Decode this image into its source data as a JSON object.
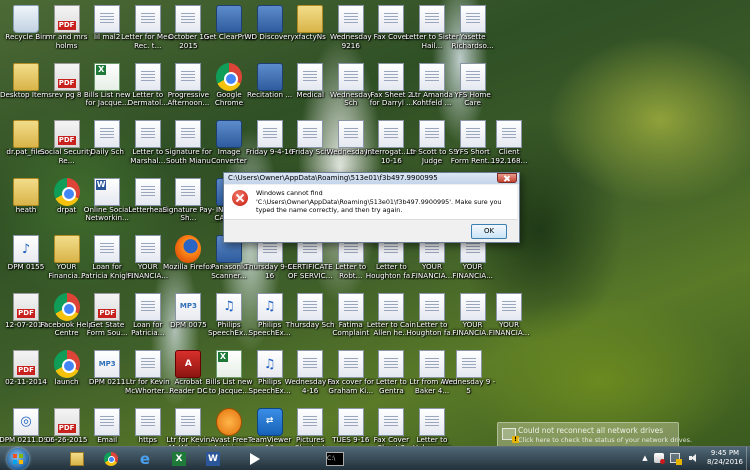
{
  "desktop": {
    "icons": [
      {
        "label": "Recycle Bin",
        "type": "recycle",
        "glyph": ""
      },
      {
        "label": "mr and mrs holms",
        "type": "pdf",
        "glyph": ""
      },
      {
        "label": "lil mal2",
        "type": "doc",
        "glyph": ""
      },
      {
        "label": "Letter for Med. Rec. t...",
        "type": "doc",
        "glyph": ""
      },
      {
        "label": "October 16 2015",
        "type": "doc",
        "glyph": ""
      },
      {
        "label": "Get ClearPrint",
        "type": "appx",
        "glyph": ""
      },
      {
        "label": "WD Discovery",
        "type": "appx",
        "glyph": ""
      },
      {
        "label": "xfactyNs",
        "type": "folder",
        "glyph": ""
      },
      {
        "label": "Wednesday 9216",
        "type": "doc",
        "glyph": ""
      },
      {
        "label": "Fax Cover",
        "type": "doc",
        "glyph": ""
      },
      {
        "label": "Letter to Sister Hail...",
        "type": "doc",
        "glyph": ""
      },
      {
        "label": "Yasette Richardso...",
        "type": "doc",
        "glyph": ""
      },
      {
        "label": "Desktop Items",
        "type": "folder",
        "glyph": ""
      },
      {
        "label": "rev pg 8",
        "type": "pdf",
        "glyph": ""
      },
      {
        "label": "Bills List new for Jacque...",
        "type": "xls",
        "glyph": ""
      },
      {
        "label": "Letter to Dermatol...",
        "type": "doc",
        "glyph": ""
      },
      {
        "label": "Progressive Afternoon...",
        "type": "doc",
        "glyph": ""
      },
      {
        "label": "Google Chrome",
        "type": "chrome",
        "glyph": ""
      },
      {
        "label": "Recitation ...",
        "type": "appx",
        "glyph": ""
      },
      {
        "label": "Medical",
        "type": "doc",
        "glyph": ""
      },
      {
        "label": "Wednesday Sch",
        "type": "doc",
        "glyph": ""
      },
      {
        "label": "Fax Sheet 2 for Darryl ...",
        "type": "doc",
        "glyph": ""
      },
      {
        "label": "Ltr Amanda Kohtfeld ...",
        "type": "doc",
        "glyph": ""
      },
      {
        "label": "YFS Home Care",
        "type": "doc",
        "glyph": ""
      },
      {
        "label": "dr.pat_files",
        "type": "folder",
        "glyph": ""
      },
      {
        "label": "Social Security Re...",
        "type": "pdf",
        "glyph": ""
      },
      {
        "label": "Daily Sch",
        "type": "doc",
        "glyph": ""
      },
      {
        "label": "Letter to Marshal...",
        "type": "doc",
        "glyph": ""
      },
      {
        "label": "Signature for South Mianu",
        "type": "doc",
        "glyph": ""
      },
      {
        "label": "Image Converter",
        "type": "appx",
        "glyph": ""
      },
      {
        "label": "Friday 9-4-16",
        "type": "doc",
        "glyph": ""
      },
      {
        "label": "Friday Sch",
        "type": "doc",
        "glyph": ""
      },
      {
        "label": "Wednesday 2",
        "type": "doc",
        "glyph": ""
      },
      {
        "label": "Interrogat... 2-10-16",
        "type": "doc",
        "glyph": ""
      },
      {
        "label": "Ltr Scott to SS Judge",
        "type": "doc",
        "glyph": ""
      },
      {
        "label": "YFS Short Form Rent...",
        "type": "doc",
        "glyph": ""
      },
      {
        "label": "Client 192.168...",
        "type": "doc",
        "glyph": ""
      },
      {
        "label": "heath",
        "type": "folder",
        "glyph": ""
      },
      {
        "label": "drpat",
        "type": "chrome",
        "glyph": ""
      },
      {
        "label": "Online Social Networkin...",
        "type": "word",
        "glyph": ""
      },
      {
        "label": "Letterhead",
        "type": "doc",
        "glyph": ""
      },
      {
        "label": "Signature Pay-Sh...",
        "type": "doc",
        "glyph": ""
      },
      {
        "label": "INDIGN CAPITAL NETWORK",
        "type": "appx",
        "glyph": ""
      },
      {
        "label": "Interrogat...",
        "type": "folder",
        "glyph": ""
      },
      {
        "label": "DPM 0155",
        "type": "audio",
        "glyph": "♪"
      },
      {
        "label": "YOUR Financia...",
        "type": "folder",
        "glyph": ""
      },
      {
        "label": "Loan for Patricia Knight",
        "type": "doc",
        "glyph": ""
      },
      {
        "label": "YOUR FINANCIA...",
        "type": "doc",
        "glyph": ""
      },
      {
        "label": "Mozilla Firefox",
        "type": "firefox",
        "glyph": ""
      },
      {
        "label": "Panasonic Scanner...",
        "type": "appx",
        "glyph": ""
      },
      {
        "label": "Thursday 9-5-16",
        "type": "doc",
        "glyph": ""
      },
      {
        "label": "CERTIFICATE OF SERVIC...",
        "type": "doc",
        "glyph": ""
      },
      {
        "label": "Letter to Robt...",
        "type": "doc",
        "glyph": ""
      },
      {
        "label": "Letter to Houghton fa...",
        "type": "doc",
        "glyph": ""
      },
      {
        "label": "YOUR FINANCIA...",
        "type": "doc",
        "glyph": ""
      },
      {
        "label": "YOUR FINANCIA...",
        "type": "doc",
        "glyph": ""
      },
      {
        "label": "12-07-2014",
        "type": "pdf",
        "glyph": ""
      },
      {
        "label": "Facebook Help Centre",
        "type": "chrome",
        "glyph": ""
      },
      {
        "label": "Get State Form Sou...",
        "type": "pdf",
        "glyph": ""
      },
      {
        "label": "Loan for Patricia...",
        "type": "doc",
        "glyph": ""
      },
      {
        "label": "DPM 0075",
        "type": "mp3",
        "glyph": "MP3"
      },
      {
        "label": "Philips SpeechEx...",
        "type": "audio",
        "glyph": "♫"
      },
      {
        "label": "Philips SpeechEx...",
        "type": "audio",
        "glyph": "♫"
      },
      {
        "label": "Thursday Sch",
        "type": "doc",
        "glyph": ""
      },
      {
        "label": "Fatima Complaint",
        "type": "doc",
        "glyph": ""
      },
      {
        "label": "Letter to Cain Allen he...",
        "type": "doc",
        "glyph": ""
      },
      {
        "label": "Letter to Houghton fa...",
        "type": "doc",
        "glyph": ""
      },
      {
        "label": "YOUR FINANCIA...",
        "type": "doc",
        "glyph": ""
      },
      {
        "label": "YOUR FINANCIA...",
        "type": "doc",
        "glyph": ""
      },
      {
        "label": "02-11-2014",
        "type": "pdf",
        "glyph": ""
      },
      {
        "label": "launch",
        "type": "chrome",
        "glyph": ""
      },
      {
        "label": "DPM 0211",
        "type": "mp3",
        "glyph": "MP3"
      },
      {
        "label": "Ltr for Kevin McWhorter...",
        "type": "doc",
        "glyph": ""
      },
      {
        "label": "Acrobat Reader DC",
        "type": "red",
        "glyph": "A"
      },
      {
        "label": "Bills List new to Jacque...",
        "type": "xls",
        "glyph": ""
      },
      {
        "label": "Philips SpeechEx...",
        "type": "audio",
        "glyph": "♫"
      },
      {
        "label": "Wednesday 9-4-16",
        "type": "doc",
        "glyph": ""
      },
      {
        "label": "Fax cover for Graham Ki...",
        "type": "doc",
        "glyph": ""
      },
      {
        "label": "Letter to Gentra",
        "type": "doc",
        "glyph": ""
      },
      {
        "label": "Ltr from Ann Baker 4...",
        "type": "doc",
        "glyph": ""
      },
      {
        "label": "Wednesday 9 - 5",
        "type": "doc",
        "glyph": ""
      },
      {
        "label": "DPM 0211.DS2",
        "type": "audio",
        "glyph": "◎"
      },
      {
        "label": "06-26-2015",
        "type": "pdf",
        "glyph": ""
      },
      {
        "label": "Email",
        "type": "doc",
        "glyph": ""
      },
      {
        "label": "https",
        "type": "doc",
        "glyph": ""
      },
      {
        "label": "Ltr for Kevin McWhorter",
        "type": "doc",
        "glyph": ""
      },
      {
        "label": "Avast Free Antivirus",
        "type": "orange",
        "glyph": ""
      },
      {
        "label": "TeamViewer 10",
        "type": "tv",
        "glyph": "⇄"
      },
      {
        "label": "Pictures Shortcut",
        "type": "doc",
        "glyph": ""
      },
      {
        "label": "TUES 9-16",
        "type": "doc",
        "glyph": ""
      },
      {
        "label": "Fax Cover Sheet 3",
        "type": "doc",
        "glyph": ""
      },
      {
        "label": "Letter to Helmsman",
        "type": "doc",
        "glyph": ""
      },
      {
        "label": "Memo to Charles Ber...",
        "type": "doc",
        "glyph": ""
      },
      {
        "label": "Avast SafeZo...",
        "type": "orange",
        "glyph": ""
      }
    ]
  },
  "dialog": {
    "title": "C:\\Users\\Owner\\AppData\\Roaming\\513e01\\f3b497.9900995",
    "message": "Windows cannot find 'C:\\Users\\Owner\\AppData\\Roaming\\513e01\\f3b497.9900995'. Make sure you typed the name correctly, and then try again.",
    "ok_label": "OK"
  },
  "notification": {
    "title": "Could not reconnect all network drives",
    "body": "Click here to check the status of your network drives."
  },
  "taskbar": {
    "clock_time": "9:45 PM",
    "clock_date": "8/24/2016",
    "cmd_label": "C:\\"
  }
}
